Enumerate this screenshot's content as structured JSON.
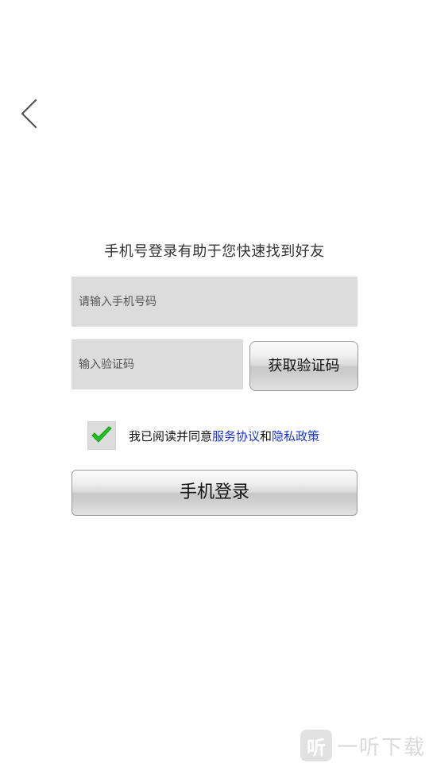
{
  "header": {
    "back_icon": "chevron-left-icon"
  },
  "main": {
    "subtitle": "手机号登录有助于您快速找到好友",
    "phone_input": {
      "placeholder": "请输入手机号码",
      "value": ""
    },
    "code_input": {
      "placeholder": "输入验证码",
      "value": ""
    },
    "get_code_label": "获取验证码",
    "agreement": {
      "checked": true,
      "check_icon": "checkmark-icon",
      "check_color": "#22c322",
      "prefix": "我已阅读并同意",
      "service_link": "服务协议",
      "conjunction": "和",
      "privacy_link": "隐私政策",
      "link_color": "#1a35d6"
    },
    "login_label": "手机登录"
  },
  "watermark": {
    "logo_glyph": "听",
    "text": "一听下载"
  }
}
